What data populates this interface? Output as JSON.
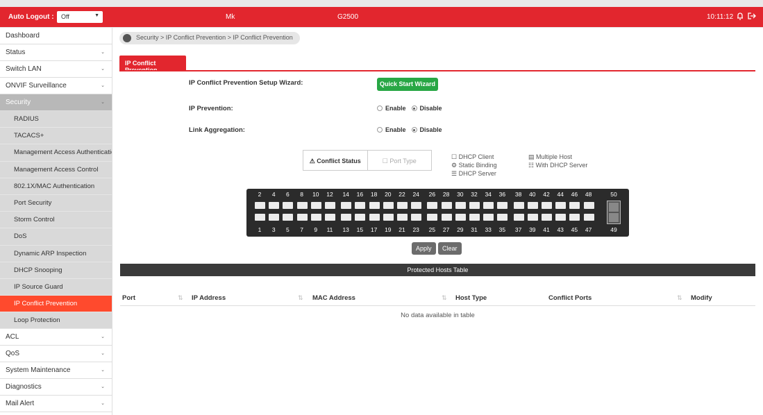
{
  "header": {
    "auto_logout_label": "Auto Logout :",
    "auto_logout_value": "Off",
    "model_left": "Mk",
    "model_right": "G2500",
    "time": "10:11:12"
  },
  "sidebar": {
    "items_top": [
      {
        "label": "Dashboard",
        "chev": ""
      },
      {
        "label": "Status",
        "chev": "⌄"
      },
      {
        "label": "Switch LAN",
        "chev": "⌄"
      },
      {
        "label": "ONVIF Surveillance",
        "chev": "⌄"
      }
    ],
    "security": {
      "label": "Security",
      "chev": "⌄"
    },
    "security_items": [
      "RADIUS",
      "TACACS+",
      "Management Access Authentication",
      "Management Access Control",
      "802.1X/MAC Authentication",
      "Port Security",
      "Storm Control",
      "DoS",
      "Dynamic ARP Inspection",
      "DHCP Snooping",
      "IP Source Guard",
      "IP Conflict Prevention",
      "Loop Protection"
    ],
    "active_index": 11,
    "items_bottom": [
      {
        "label": "ACL",
        "chev": "⌄"
      },
      {
        "label": "QoS",
        "chev": "⌄"
      },
      {
        "label": "System Maintenance",
        "chev": "⌄"
      },
      {
        "label": "Diagnostics",
        "chev": "⌄"
      },
      {
        "label": "Mail Alert",
        "chev": "⌄"
      }
    ]
  },
  "breadcrumb": "Security > IP Conflict Prevention > IP Conflict Prevention",
  "tab": "IP Conflict Prevention",
  "form": {
    "wizard_label": "IP Conflict Prevention Setup Wizard:",
    "wizard_button": "Quick Start Wizard",
    "prevention_label": "IP Prevention:",
    "aggregation_label": "Link Aggregation:",
    "enable": "Enable",
    "disable": "Disable",
    "prevention_value": "Disable",
    "aggregation_value": "Disable"
  },
  "status": {
    "conflict": "Conflict Status",
    "port_type": "Port Type",
    "legend_left": [
      "DHCP Client",
      "Static Binding",
      "DHCP Server"
    ],
    "legend_right": [
      "Multiple Host",
      "With DHCP Server"
    ]
  },
  "ports": {
    "top": [
      "2",
      "4",
      "6",
      "8",
      "10",
      "12",
      "14",
      "16",
      "18",
      "20",
      "22",
      "24",
      "26",
      "28",
      "30",
      "32",
      "34",
      "36",
      "38",
      "40",
      "42",
      "44",
      "46",
      "48"
    ],
    "bottom": [
      "1",
      "3",
      "5",
      "7",
      "9",
      "11",
      "13",
      "15",
      "17",
      "19",
      "21",
      "23",
      "25",
      "27",
      "29",
      "31",
      "33",
      "35",
      "37",
      "39",
      "41",
      "43",
      "45",
      "47"
    ],
    "sfp_top": "50",
    "sfp_bottom": "49"
  },
  "buttons": {
    "apply": "Apply",
    "clear": "Clear"
  },
  "table": {
    "title": "Protected Hosts Table",
    "columns": [
      "Port",
      "IP Address",
      "MAC Address",
      "Host Type",
      "Conflict Ports",
      "Modify"
    ],
    "empty": "No data available in table"
  },
  "colors": {
    "brand_red": "#e2262e",
    "active_orange": "#ff4a2d",
    "green": "#28a745"
  }
}
